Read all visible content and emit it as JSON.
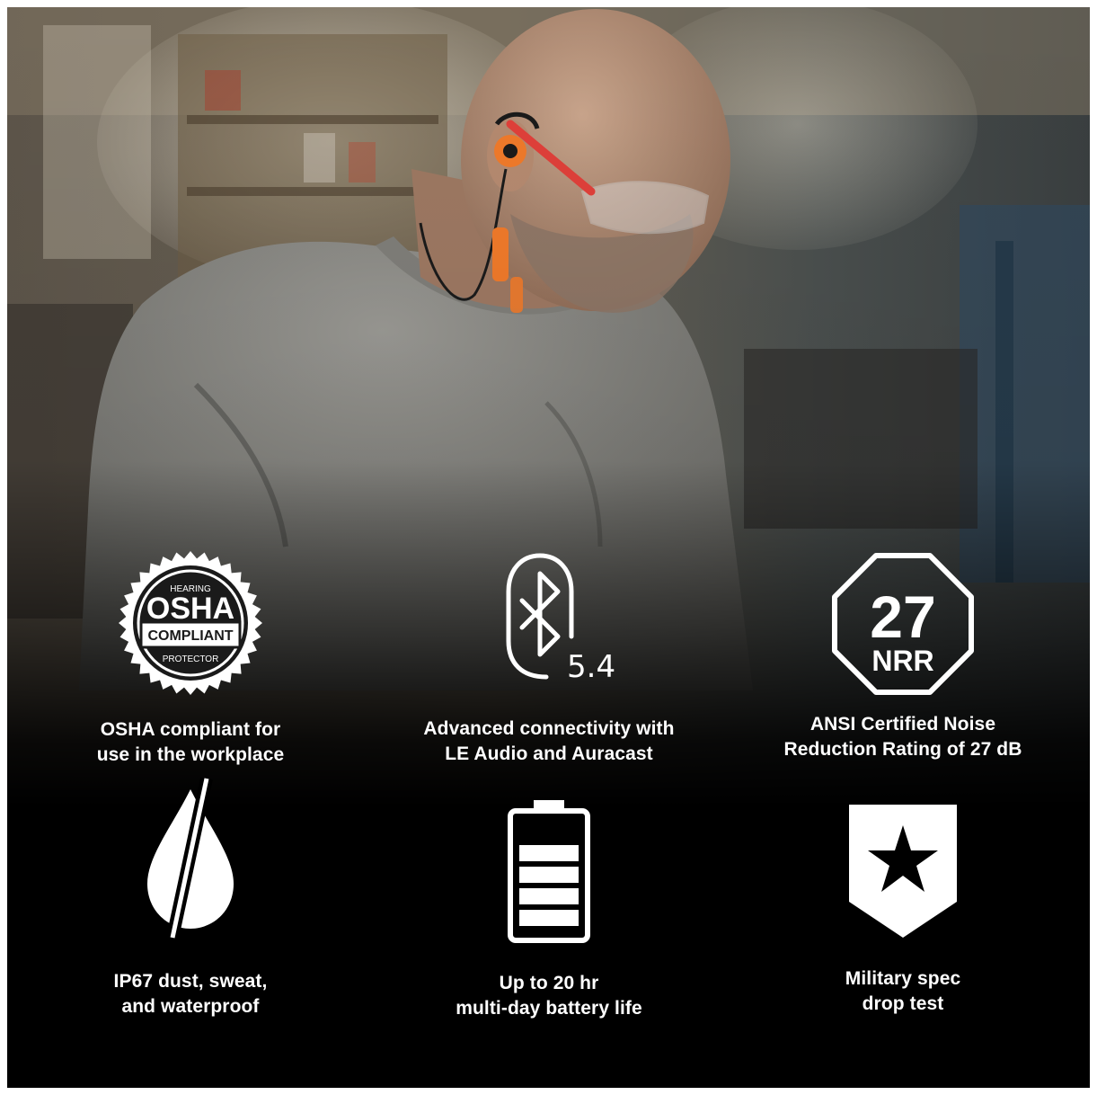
{
  "hero": {
    "scene": "man-wearing-orange-earbuds-and-safety-glasses-in-workshop"
  },
  "badges": {
    "osha": {
      "top": "HEARING",
      "main": "OSHA",
      "middle": "COMPLIANT",
      "bottom": "PROTECTOR"
    },
    "bluetooth": {
      "version": "5.4"
    },
    "nrr": {
      "value": "27",
      "unit": "NRR"
    }
  },
  "features": [
    {
      "icon": "osha-badge-icon",
      "line1": "OSHA compliant for",
      "line2": "use in the workplace"
    },
    {
      "icon": "bluetooth-icon",
      "line1": "Advanced connectivity with",
      "line2": "LE Audio and Auracast"
    },
    {
      "icon": "nrr-octagon-icon",
      "line1": "ANSI Certified Noise",
      "line2": "Reduction Rating of 27 dB"
    },
    {
      "icon": "waterproof-drop-icon",
      "line1": "IP67 dust, sweat,",
      "line2": "and waterproof"
    },
    {
      "icon": "battery-icon",
      "line1": "Up to 20 hr",
      "line2": "multi-day battery life"
    },
    {
      "icon": "military-shield-star-icon",
      "line1": "Military spec",
      "line2": "drop test"
    }
  ],
  "colors": {
    "background": "#000000",
    "text": "#ffffff",
    "accent_orange": "#f07a2a",
    "badge_dark": "#1a1a1a"
  }
}
